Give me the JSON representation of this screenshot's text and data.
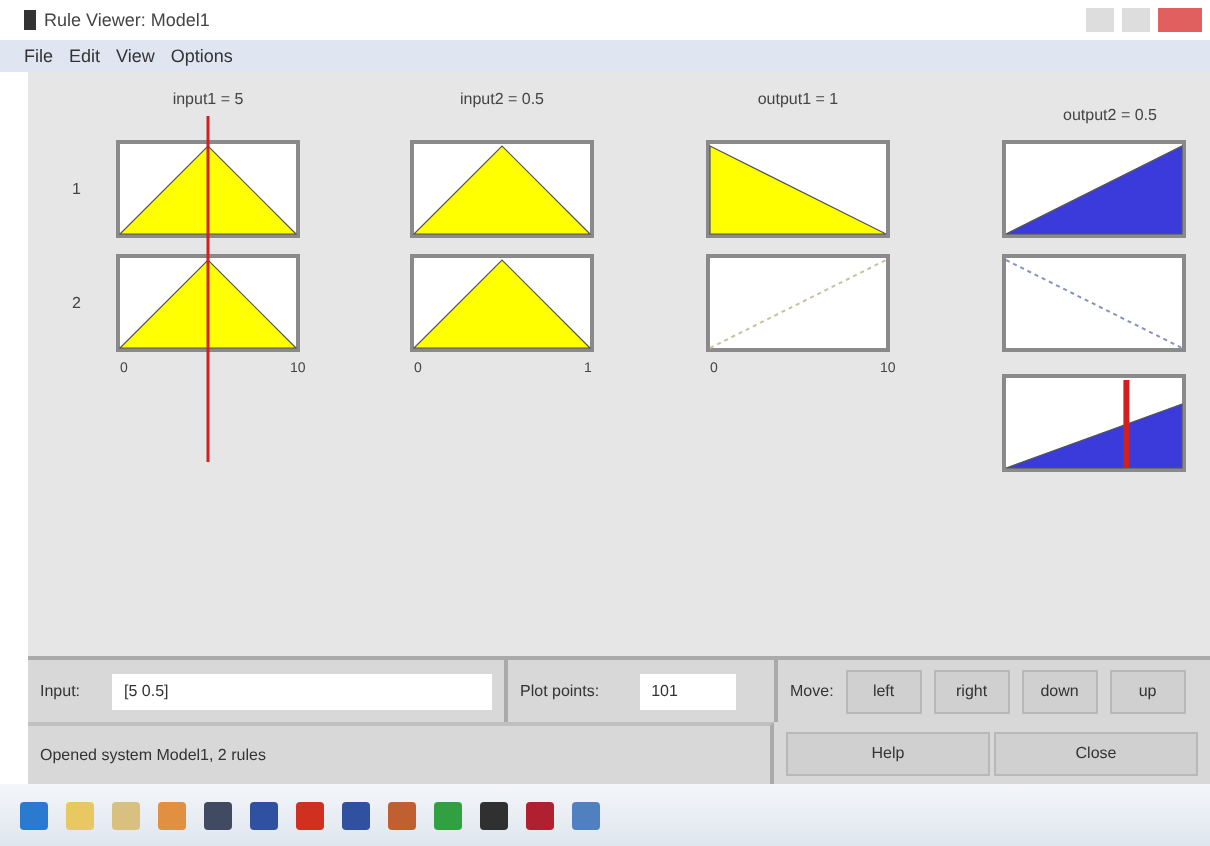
{
  "window": {
    "title": "Rule Viewer: Model1"
  },
  "menu": [
    "File",
    "Edit",
    "View",
    "Options"
  ],
  "rule_numbers": [
    "1",
    "2"
  ],
  "columns": [
    {
      "title": "input1 = 5",
      "kind": "input",
      "ticks": [
        "0",
        "10"
      ],
      "level": 0.5,
      "plots": [
        {
          "kind": "triangle"
        },
        {
          "kind": "triangle"
        }
      ]
    },
    {
      "title": "input2 = 0.5",
      "kind": "input",
      "ticks": [
        "0",
        "1"
      ],
      "plots": [
        {
          "kind": "triangle"
        },
        {
          "kind": "triangle"
        }
      ]
    },
    {
      "title": "output1 = 1",
      "kind": "input",
      "ticks": [
        "0",
        "10"
      ],
      "plots": [
        {
          "kind": "fall"
        },
        {
          "kind": "rise-line"
        }
      ]
    },
    {
      "title": "output2 = 0.5",
      "kind": "output",
      "level": 0.68,
      "plots": [
        {
          "kind": "rise"
        },
        {
          "kind": "fall-line"
        },
        {
          "kind": "rise"
        }
      ]
    }
  ],
  "input": {
    "label": "Input:",
    "value": "[5 0.5]"
  },
  "plot_points": {
    "label": "Plot points:",
    "value": "101"
  },
  "move": {
    "label": "Move:",
    "buttons": [
      "left",
      "right",
      "down",
      "up"
    ]
  },
  "status": "Opened system Model1, 2 rules",
  "buttons": [
    "Help",
    "Close"
  ],
  "taskbar": {
    "icons": [
      {
        "kind": "start"
      },
      {
        "kind": "folder"
      },
      {
        "kind": "files"
      },
      {
        "kind": "media"
      },
      {
        "kind": "disk"
      },
      {
        "kind": "monitor"
      },
      {
        "kind": "office"
      },
      {
        "kind": "tool"
      },
      {
        "kind": "paint"
      },
      {
        "kind": "browser"
      },
      {
        "kind": "phone"
      },
      {
        "kind": "app"
      },
      {
        "kind": "matlab"
      }
    ]
  }
}
